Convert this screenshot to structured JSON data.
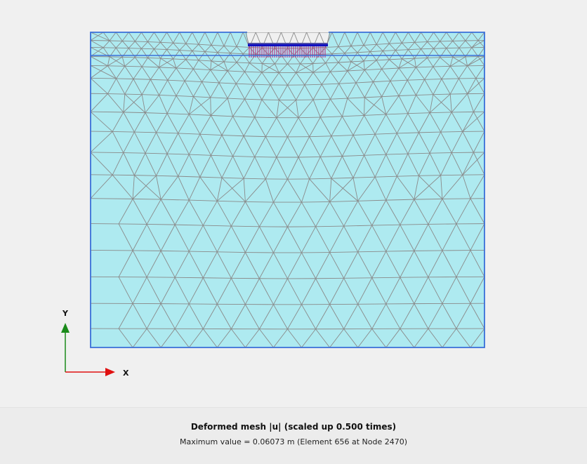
{
  "caption": {
    "title": "Deformed mesh |u| (scaled up 0.500 times)",
    "max_value": "Maximum value = 0.06073 m (Element 656 at Node 2470)"
  },
  "axes": {
    "y_label": "Y",
    "x_label": "X"
  },
  "colors": {
    "soil_fill": "#aeeaf0",
    "boundary": "#3a6fd8",
    "mesh_line": "#8a8a8a",
    "footing": "#1010c0",
    "load_arrows": "#c0167a",
    "y_axis": "#1a8a1a",
    "x_axis": "#e01010",
    "background": "#f0f0f0"
  }
}
